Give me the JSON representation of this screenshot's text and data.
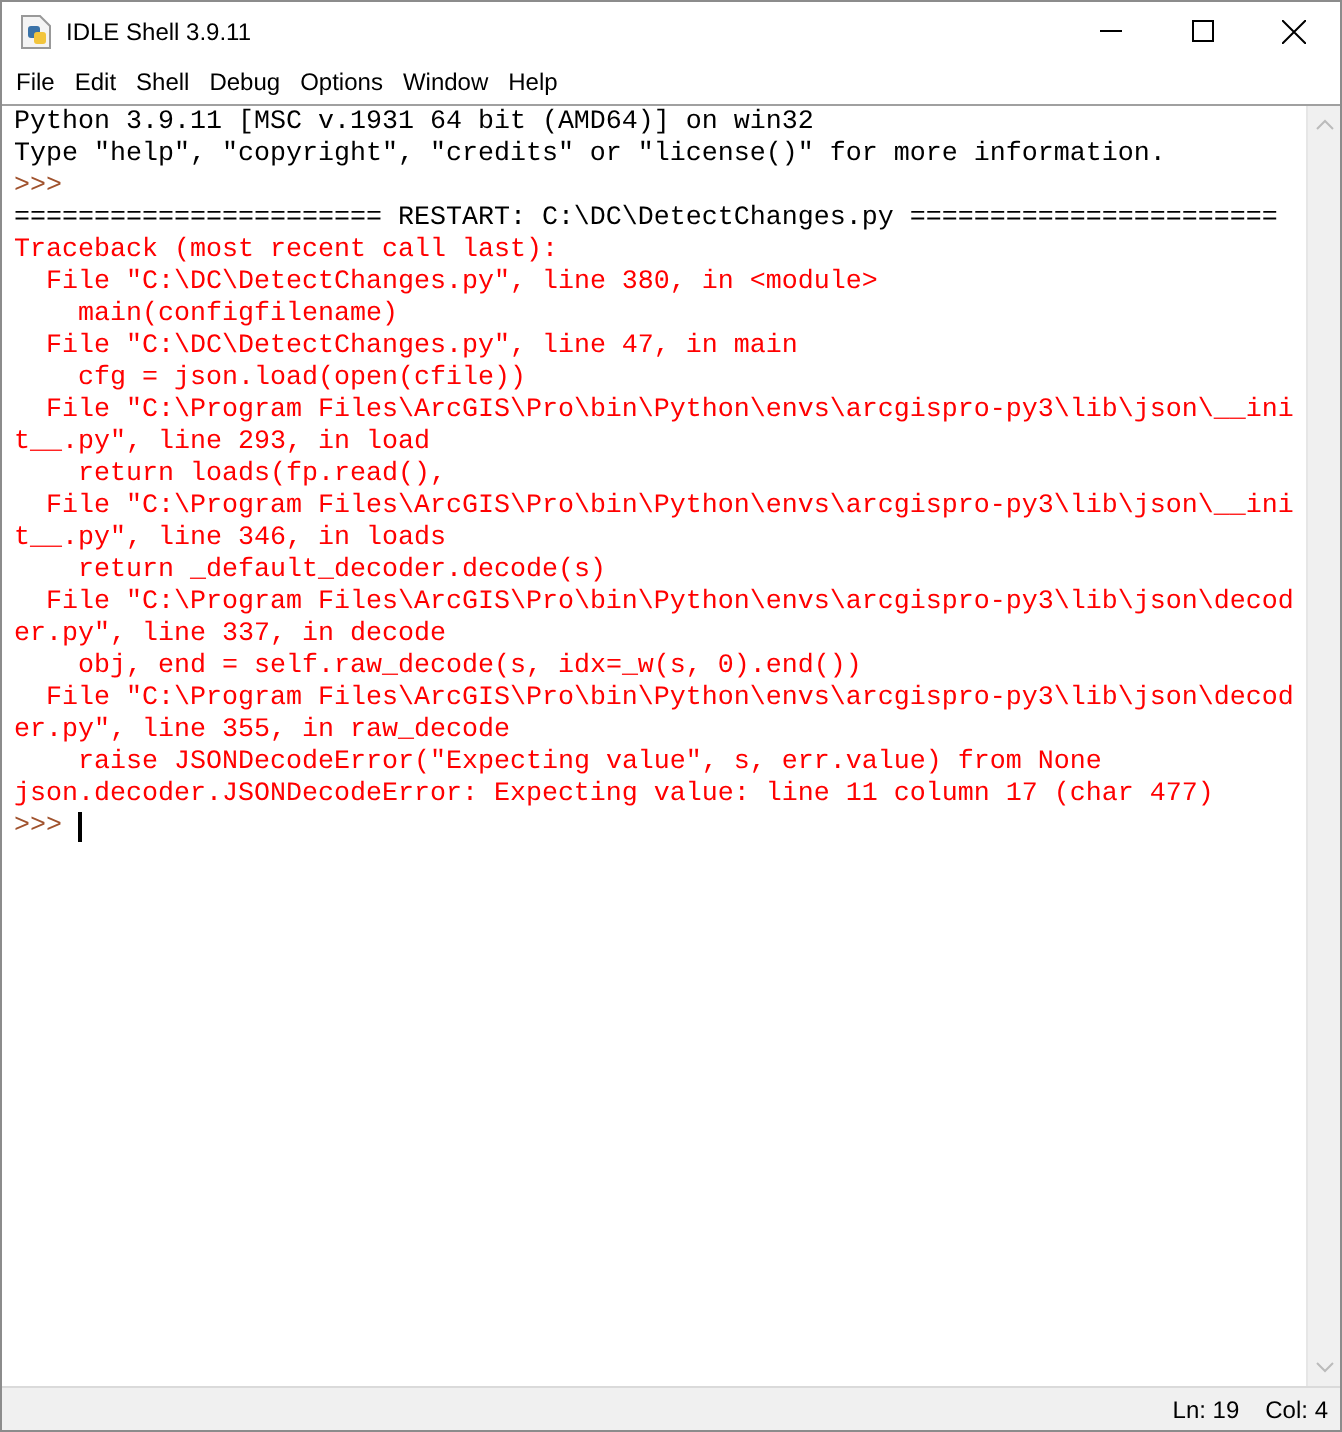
{
  "window": {
    "title": "IDLE Shell 3.9.11"
  },
  "menu": [
    "File",
    "Edit",
    "Shell",
    "Debug",
    "Options",
    "Window",
    "Help"
  ],
  "shell_lines": [
    {
      "kind": "output",
      "text": "Python 3.9.11 [MSC v.1931 64 bit (AMD64)] on win32"
    },
    {
      "kind": "output",
      "text": "Type \"help\", \"copyright\", \"credits\" or \"license()\" for more information."
    },
    {
      "kind": "prompt",
      "text": ">>>"
    },
    {
      "kind": "output",
      "text": "======================= RESTART: C:\\DC\\DetectChanges.py ======================="
    },
    {
      "kind": "error",
      "text": "Traceback (most recent call last):"
    },
    {
      "kind": "error",
      "text": "  File \"C:\\DC\\DetectChanges.py\", line 380, in <module>"
    },
    {
      "kind": "error",
      "text": "    main(configfilename)"
    },
    {
      "kind": "error",
      "text": "  File \"C:\\DC\\DetectChanges.py\", line 47, in main"
    },
    {
      "kind": "error",
      "text": "    cfg = json.load(open(cfile))"
    },
    {
      "kind": "error",
      "text": "  File \"C:\\Program Files\\ArcGIS\\Pro\\bin\\Python\\envs\\arcgispro-py3\\lib\\json\\__init__.py\", line 293, in load"
    },
    {
      "kind": "error",
      "text": "    return loads(fp.read(),"
    },
    {
      "kind": "error",
      "text": "  File \"C:\\Program Files\\ArcGIS\\Pro\\bin\\Python\\envs\\arcgispro-py3\\lib\\json\\__init__.py\", line 346, in loads"
    },
    {
      "kind": "error",
      "text": "    return _default_decoder.decode(s)"
    },
    {
      "kind": "error",
      "text": "  File \"C:\\Program Files\\ArcGIS\\Pro\\bin\\Python\\envs\\arcgispro-py3\\lib\\json\\decoder.py\", line 337, in decode"
    },
    {
      "kind": "error",
      "text": "    obj, end = self.raw_decode(s, idx=_w(s, 0).end())"
    },
    {
      "kind": "error",
      "text": "  File \"C:\\Program Files\\ArcGIS\\Pro\\bin\\Python\\envs\\arcgispro-py3\\lib\\json\\decoder.py\", line 355, in raw_decode"
    },
    {
      "kind": "error",
      "text": "    raise JSONDecodeError(\"Expecting value\", s, err.value) from None"
    },
    {
      "kind": "error",
      "text": "json.decoder.JSONDecodeError: Expecting value: line 11 column 17 (char 477)"
    },
    {
      "kind": "prompt",
      "text": ">>>",
      "cursor": true
    }
  ],
  "status_bar": {
    "line": "Ln: 19",
    "column": "Col: 4"
  }
}
